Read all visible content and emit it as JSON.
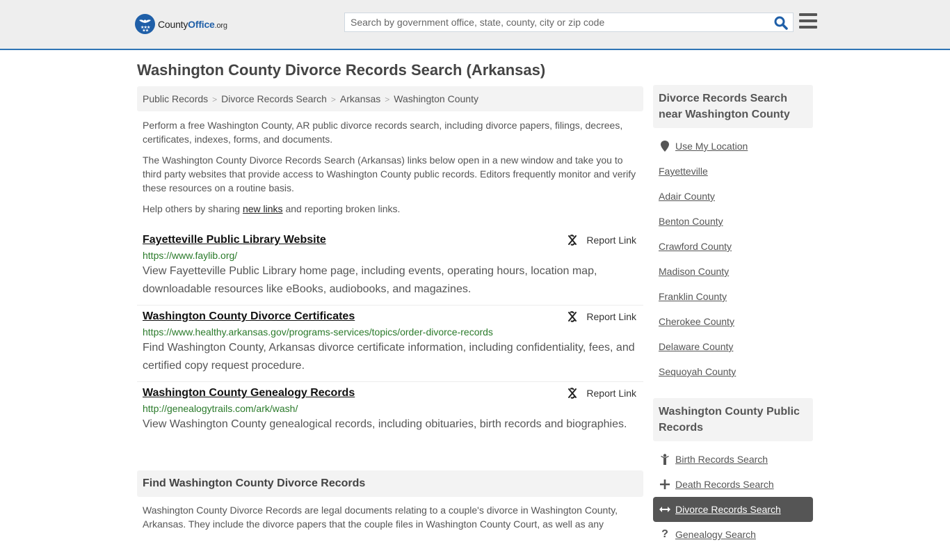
{
  "header": {
    "logo": {
      "name_part1": "County",
      "name_part2": "Office",
      "suffix": ".org"
    },
    "search": {
      "placeholder": "Search by government office, state, county, city or zip code",
      "value": ""
    },
    "accent_color": "#2f75b5"
  },
  "page": {
    "title": "Washington County Divorce Records Search (Arkansas)"
  },
  "breadcrumb": [
    {
      "label": "Public Records"
    },
    {
      "label": "Divorce Records Search"
    },
    {
      "label": "Arkansas"
    },
    {
      "label": "Washington County"
    }
  ],
  "intro": {
    "p1": "Perform a free Washington County, AR public divorce records search, including divorce papers, filings, decrees, certificates, indexes, forms, and documents.",
    "p2": "The Washington County Divorce Records Search (Arkansas) links below open in a new window and take you to third party websites that provide access to Washington County public records. Editors frequently monitor and verify these resources on a routine basis.",
    "p3_before": "Help others by sharing ",
    "p3_link": "new links",
    "p3_after": " and reporting broken links."
  },
  "results": [
    {
      "title": "Fayetteville Public Library Website",
      "url": "https://www.faylib.org/",
      "description": "View Fayetteville Public Library home page, including events, operating hours, location map, downloadable resources like eBooks, audiobooks, and magazines.",
      "report_label": "Report Link"
    },
    {
      "title": "Washington County Divorce Certificates",
      "url": "https://www.healthy.arkansas.gov/programs-services/topics/order-divorce-records",
      "description": "Find Washington County, Arkansas divorce certificate information, including confidentiality, fees, and certified copy request procedure.",
      "report_label": "Report Link"
    },
    {
      "title": "Washington County Genealogy Records",
      "url": "http://genealogytrails.com/ark/wash/",
      "description": "View Washington County genealogical records, including obituaries, birth records and biographies.",
      "report_label": "Report Link"
    }
  ],
  "find_section": {
    "heading": "Find Washington County Divorce Records",
    "text": "Washington County Divorce Records are legal documents relating to a couple's divorce in Washington County, Arkansas. They include the divorce papers that the couple files in Washington County Court, as well as any"
  },
  "sidebar": {
    "nearby": {
      "heading": "Divorce Records Search near Washington County",
      "use_location": "Use My Location",
      "items": [
        "Fayetteville",
        "Adair County",
        "Benton County",
        "Crawford County",
        "Madison County",
        "Franklin County",
        "Cherokee County",
        "Delaware County",
        "Sequoyah County"
      ]
    },
    "public_records": {
      "heading": "Washington County Public Records",
      "items": [
        {
          "label": "Birth Records Search",
          "icon": "child-icon",
          "active": false
        },
        {
          "label": "Death Records Search",
          "icon": "plus-icon",
          "active": false
        },
        {
          "label": "Divorce Records Search",
          "icon": "arrows-horizontal-icon",
          "active": true
        },
        {
          "label": "Genealogy Search",
          "icon": "question-icon",
          "active": false
        }
      ]
    }
  }
}
